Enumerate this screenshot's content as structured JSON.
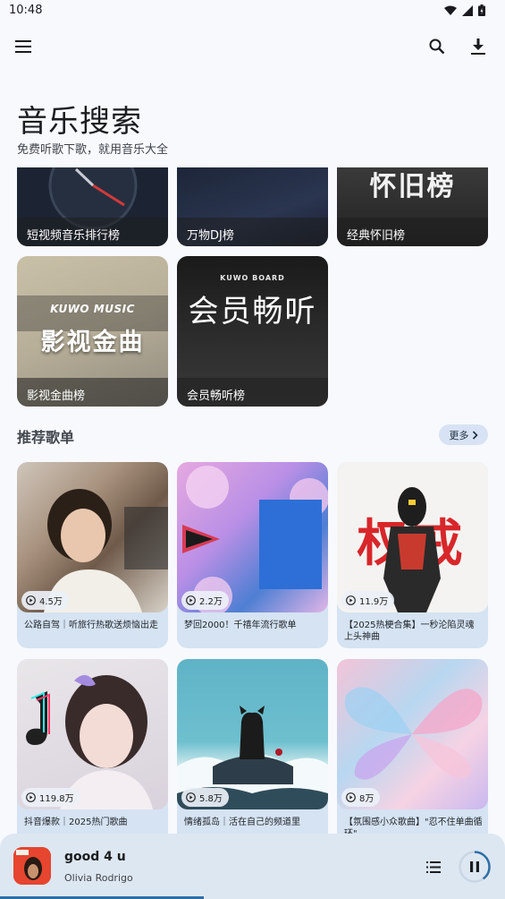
{
  "status": {
    "time": "10:48"
  },
  "header": {
    "title": "音乐搜索",
    "subtitle": "免费听歌下歌，就用音乐大全"
  },
  "rankings": [
    {
      "label": "短视频音乐排行榜"
    },
    {
      "label": "万物DJ榜"
    },
    {
      "label": "经典怀旧榜",
      "art_text": "怀旧榜"
    },
    {
      "label": "影视金曲榜",
      "art_brand": "KUWO MUSIC",
      "art_text": "影视金曲"
    },
    {
      "label": "会员畅听榜",
      "art_brand": "KUWO BOARD",
      "art_text": "会员畅听"
    }
  ],
  "recommend": {
    "title": "推荐歌单",
    "more_label": "更多",
    "playlists": [
      {
        "count": "4.5万",
        "name": "公路自驾｜听旅行热歌送烦恼出走"
      },
      {
        "count": "2.2万",
        "name": "梦回2000！千禧年流行歌单"
      },
      {
        "count": "11.9万",
        "name": "【2025热梗合集】一秒沦陷灵魂上头神曲",
        "art_text": "权戒"
      },
      {
        "count": "119.8万",
        "name": "抖音爆款｜2025热门歌曲"
      },
      {
        "count": "5.8万",
        "name": "情绪孤岛｜活在自己的频道里"
      },
      {
        "count": "8万",
        "name": "【氛围感小众歌曲】\"忍不住单曲循环\""
      }
    ]
  },
  "player": {
    "title": "good 4 u",
    "artist": "Olivia Rodrigo",
    "progress": 0.4
  },
  "colors": {
    "accent": "#2e6ea6",
    "chip": "#d7e3f4",
    "card": "#d5e3f2"
  }
}
